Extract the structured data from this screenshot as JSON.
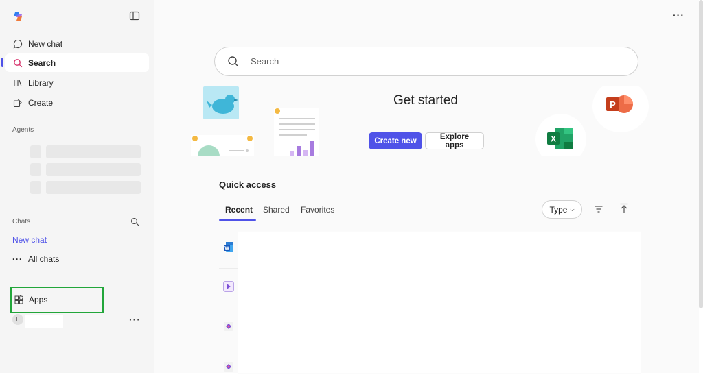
{
  "sidebar": {
    "nav": {
      "new_chat": "New chat",
      "search": "Search",
      "library": "Library",
      "create": "Create"
    },
    "agents_label": "Agents",
    "chats_label": "Chats",
    "chats_new_chat": "New chat",
    "all_chats": "All chats",
    "apps": "Apps",
    "user_initial": "H"
  },
  "main": {
    "search_placeholder": "Search",
    "get_started": "Get started",
    "create_new": "Create new",
    "explore_apps": "Explore apps",
    "quick_access": "Quick access",
    "tabs": [
      "Recent",
      "Shared",
      "Favorites"
    ],
    "type_filter": "Type"
  },
  "colors": {
    "accent": "#4f52e8",
    "highlight_box": "#22a63a"
  }
}
